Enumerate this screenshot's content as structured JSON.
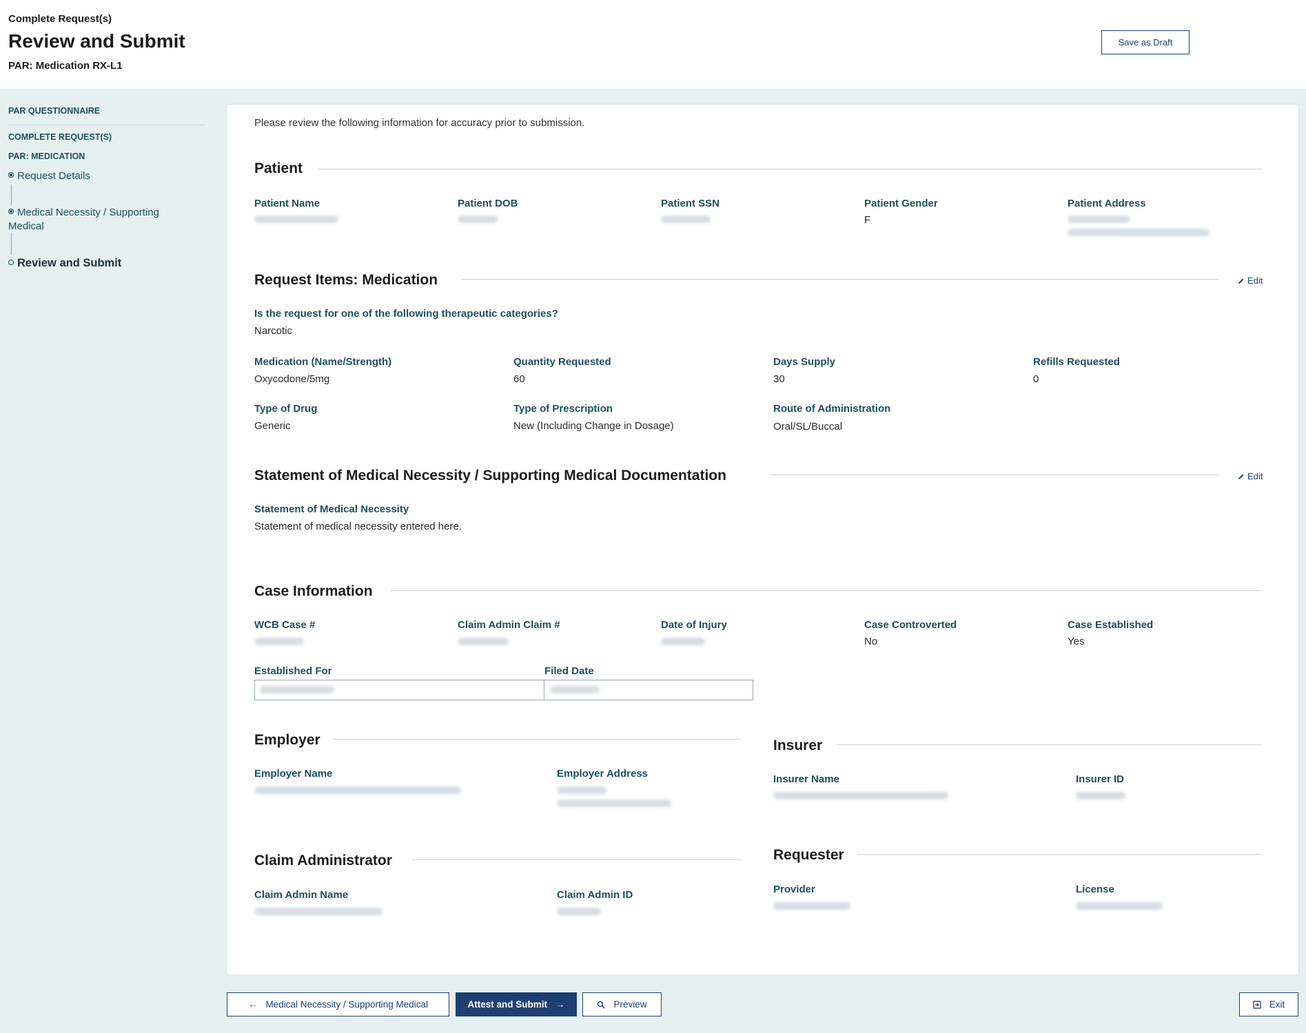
{
  "header": {
    "eyebrow": "Complete Request(s)",
    "title": "Review and Submit",
    "subtitle": "PAR: Medication RX-L1",
    "save_draft_label": "Save as Draft"
  },
  "sidebar": {
    "heading_questionnaire": "PAR QUESTIONNAIRE",
    "heading_complete": "COMPLETE REQUEST(S)",
    "heading_medication": "PAR: MEDICATION",
    "items": [
      {
        "label": "Request Details"
      },
      {
        "label": "Medical Necessity / Supporting Medical"
      },
      {
        "label": "Review and Submit"
      }
    ]
  },
  "intro": "Please review the following information for accuracy prior to submission.",
  "patient": {
    "title": "Patient",
    "labels": {
      "name": "Patient Name",
      "dob": "Patient DOB",
      "ssn": "Patient SSN",
      "gender": "Patient Gender",
      "address": "Patient Address"
    },
    "gender": "F"
  },
  "request_items": {
    "title": "Request Items: Medication",
    "edit_label": "Edit",
    "q_label": "Is the request for one of the following therapeutic categories?",
    "q_value": "Narcotic",
    "fields": {
      "medication_label": "Medication (Name/Strength)",
      "medication": "Oxycodone/5mg",
      "quantity_label": "Quantity Requested",
      "quantity": "60",
      "days_label": "Days Supply",
      "days": "30",
      "refills_label": "Refills Requested",
      "refills": "0",
      "drug_type_label": "Type of Drug",
      "drug_type": "Generic",
      "rx_type_label": "Type of Prescription",
      "rx_type": "New (Including Change in Dosage)",
      "route_label": "Route of Administration",
      "route": "Oral/SL/Buccal"
    }
  },
  "necessity": {
    "title": "Statement of Medical Necessity / Supporting Medical Documentation",
    "edit_label": "Edit",
    "label": "Statement of Medical Necessity",
    "value": "Statement of medical necessity entered here."
  },
  "case_info": {
    "title": "Case Information",
    "labels": {
      "wcb": "WCB Case #",
      "claim": "Claim Admin Claim #",
      "doi": "Date of Injury",
      "controverted": "Case Controverted",
      "established": "Case Established",
      "established_for": "Established For",
      "filed_date": "Filed Date"
    },
    "controverted": "No",
    "established": "Yes"
  },
  "employer": {
    "title": "Employer",
    "name_label": "Employer Name",
    "address_label": "Employer Address"
  },
  "insurer": {
    "title": "Insurer",
    "name_label": "Insurer Name",
    "id_label": "Insurer ID"
  },
  "claim_admin": {
    "title": "Claim Administrator",
    "name_label": "Claim Admin Name",
    "id_label": "Claim Admin ID"
  },
  "requester": {
    "title": "Requester",
    "provider_label": "Provider",
    "license_label": "License"
  },
  "footer": {
    "back_label": "Medical Necessity / Supporting Medical",
    "attest_label": "Attest and Submit",
    "preview_label": "Preview",
    "exit_label": "Exit"
  },
  "icons": {
    "back": "arrow-left-icon",
    "next": "arrow-right-icon",
    "preview": "search-icon",
    "exit": "exit-icon",
    "edit": "pencil-icon"
  },
  "colors": {
    "primary": "#1f3f73",
    "label": "#1d4f5c",
    "background": "#e6f0f1"
  }
}
